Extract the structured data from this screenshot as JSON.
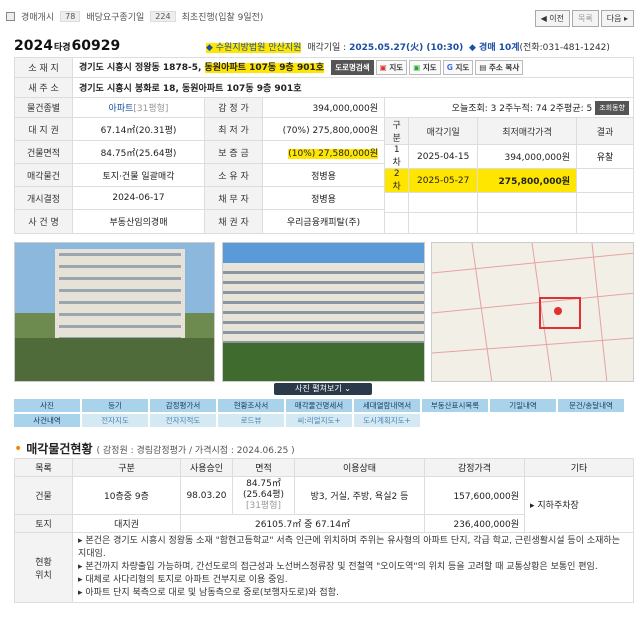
{
  "top": {
    "crumb1": "경매개시",
    "crumb1_count": "78",
    "crumb2": "배당요구종기일",
    "crumb2_count": "224",
    "crumb3": "최초진행(입찰 9일전)",
    "prev": "◀ 이전",
    "list": "목록",
    "next": "다음 ▸"
  },
  "case": {
    "year": "2024",
    "type": "타경",
    "number": "60929",
    "court": "◆ 수원지방법원 안산지원",
    "sale_label": "매각기일 :",
    "sale_date": "2025.05.27(火) (10:30)",
    "dept": "◆ 경매 10계",
    "phone": "(전화:031-481-1242)"
  },
  "summary": {
    "addr_label": "소 재 지",
    "addr_main": "경기도 시흥시 정왕동 1878-5,",
    "addr_hl": "동원아파트 107동 9층 901호",
    "road_btn": "도로명검색",
    "map1": "지도",
    "map2": "지도",
    "map3": "지도",
    "copy": "주소 복사",
    "new_addr_label": "새 주 소",
    "new_addr": "경기도 시흥시 봉화로 18, 동원아파트 107동 9층 901호",
    "rows": [
      {
        "l1": "물건종별",
        "v1": "아파트",
        "v1b": "[31평형]",
        "l2": "감 정 가",
        "v2": "394,000,000원"
      },
      {
        "l1": "대 지 권",
        "v1": "67.14㎡(20.31평)",
        "l2": "최 저 가",
        "v2": "(70%) 275,800,000원"
      },
      {
        "l1": "건물면적",
        "v1": "84.75㎡(25.64평)",
        "l2": "보 증 금",
        "v2": "(10%) 27,580,000원"
      },
      {
        "l1": "매각물건",
        "v1": "토지·건물 일괄매각",
        "l2": "소 유 자",
        "v2": "정병용"
      },
      {
        "l1": "개시결정",
        "v1": "2024-06-17",
        "l2": "채 무 자",
        "v2": "정병용"
      },
      {
        "l1": "사 건 명",
        "v1": "부동산임의경매",
        "l2": "채 권 자",
        "v2": "우리금융캐피탈(주)"
      }
    ],
    "views": "오늘조회: 3  2주누적: 74  2주평균: 5",
    "views_btn": "조회동향",
    "hist_head": [
      "구분",
      "매각기일",
      "최저매각가격",
      "결과"
    ],
    "hist": [
      {
        "n": "1차",
        "d": "2025-04-15",
        "p": "394,000,000원",
        "r": "유찰"
      },
      {
        "n": "2차",
        "d": "2025-05-27",
        "p": "275,800,000원",
        "r": ""
      }
    ]
  },
  "photos": {
    "slide": "사진 펼쳐보기 ⌄"
  },
  "tabs": [
    [
      "사진",
      "등기",
      "감정평가서",
      "현황조사서",
      "매각물건명세서",
      "세대열람내역서",
      "부동산표시목록",
      "기일내역",
      "문건/송달내역"
    ],
    [
      "사건내역",
      "전자지도",
      "전자지적도",
      "로드뷰",
      "씨:리얼지도+",
      "도시계획지도+"
    ]
  ],
  "section": {
    "title": "매각물건현황",
    "sub": "( 감정원 : 경림감정평가 / 가격시점 : 2024.06.25 )"
  },
  "detail": {
    "head": [
      "목록",
      "구분",
      "사용승인",
      "면적",
      "이용상태",
      "감정가격",
      "기타"
    ],
    "bldg": {
      "c1": "건물",
      "c2": "10층중 9층",
      "c3": "98.03.20",
      "c4a": "84.75㎡",
      "c4b": "(25.64평)",
      "c4c": "[31평형]",
      "c5": "방3, 거실, 주방, 욕실2 등",
      "c6": "157,600,000원",
      "c7": "▸ 지하주차장"
    },
    "land": {
      "c1": "토지",
      "c2": "대지권",
      "c4": "26105.7㎡ 중 67.14㎡",
      "c6": "236,400,000원"
    },
    "loc_label": "현황\n위치",
    "loc": [
      "▸ 본건은 경기도 시흥시 정왕동 소재 \"함현고등학교\" 서측 인근에 위치하며 주위는 유사형의 아파트 단지, 각급 학교, 근린생활시설 등이 소재하는 지대임.",
      "▸ 본건까지 차량출입 가능하며, 간선도로의 접근성과 노선버스정류장 및 전철역 \"오이도역\"의 위치 등을 고려할 때 교통상황은 보통인 편임.",
      "▸ 대체로 사다리형의 토지로 아파트 건부지로 이용 중임.",
      "▸ 아파트 단지 북측으로 대로 및 남동측으로 중로(보행자도로)와 접함."
    ]
  },
  "colors": {
    "highlight": "#ffe600",
    "link": "#1a4fa3",
    "tab": "#a9d3ea",
    "accent": "#f08a00"
  }
}
